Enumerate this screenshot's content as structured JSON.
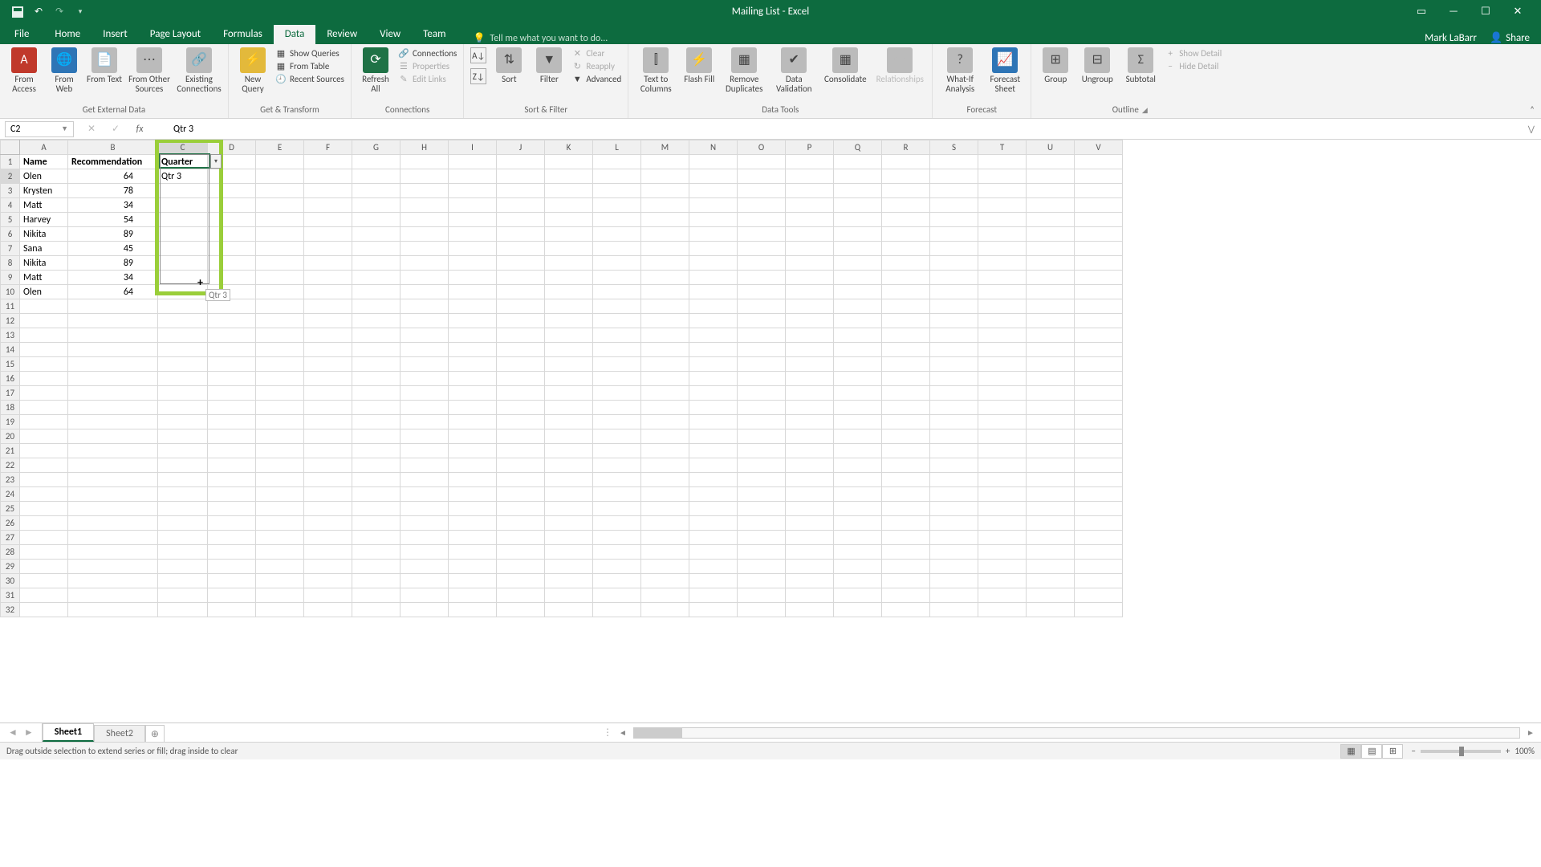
{
  "title": "Mailing List - Excel",
  "user": "Mark LaBarr",
  "share_label": "Share",
  "tabs": [
    "File",
    "Home",
    "Insert",
    "Page Layout",
    "Formulas",
    "Data",
    "Review",
    "View",
    "Team"
  ],
  "active_tab": "Data",
  "tellme_placeholder": "Tell me what you want to do...",
  "ribbon": {
    "groups": {
      "ext": {
        "label": "Get External Data",
        "items": [
          "From Access",
          "From Web",
          "From Text",
          "From Other Sources",
          "Existing Connections"
        ]
      },
      "trans": {
        "label": "Get & Transform",
        "new_query": "New Query",
        "show_queries": "Show Queries",
        "from_table": "From Table",
        "recent_sources": "Recent Sources"
      },
      "conn": {
        "label": "Connections",
        "refresh": "Refresh All",
        "connections": "Connections",
        "properties": "Properties",
        "edit_links": "Edit Links"
      },
      "sortf": {
        "label": "Sort & Filter",
        "sort": "Sort",
        "filter": "Filter",
        "clear": "Clear",
        "reapply": "Reapply",
        "advanced": "Advanced"
      },
      "tools": {
        "label": "Data Tools",
        "text_to_cols": "Text to Columns",
        "flash_fill": "Flash Fill",
        "remove_dup": "Remove Duplicates",
        "validation": "Data Validation",
        "consolidate": "Consolidate",
        "relationships": "Relationships"
      },
      "forecast": {
        "label": "Forecast",
        "whatif": "What-If Analysis",
        "fsheet": "Forecast Sheet"
      },
      "outline": {
        "label": "Outline",
        "group": "Group",
        "ungroup": "Ungroup",
        "subtotal": "Subtotal",
        "show_detail": "Show Detail",
        "hide_detail": "Hide Detail"
      }
    }
  },
  "namebox": "C2",
  "formula_value": "Qtr 3",
  "columns": [
    "A",
    "B",
    "C",
    "D",
    "E",
    "F",
    "G",
    "H",
    "I",
    "J",
    "K",
    "L",
    "M",
    "N",
    "O",
    "P",
    "Q",
    "R",
    "S",
    "T",
    "U",
    "V"
  ],
  "col_widths": {
    "A": 60,
    "B": 112,
    "C": 62,
    "default": 60
  },
  "rows_visible": 32,
  "headers": {
    "A": "Name",
    "B": "Recommendation",
    "C": "Quarter"
  },
  "data_rows": [
    {
      "A": "Olen",
      "B": "64"
    },
    {
      "A": "Krysten",
      "B": "78"
    },
    {
      "A": "Matt",
      "B": "34"
    },
    {
      "A": "Harvey",
      "B": "54"
    },
    {
      "A": "Nikita",
      "B": "89"
    },
    {
      "A": "Sana",
      "B": "45"
    },
    {
      "A": "Nikita",
      "B": "89"
    },
    {
      "A": "Matt",
      "B": "34"
    },
    {
      "A": "Olen",
      "B": "64"
    }
  ],
  "cell_C2": "Qtr 3",
  "drag_tooltip": "Qtr 3",
  "sheets": [
    "Sheet1",
    "Sheet2"
  ],
  "active_sheet": "Sheet1",
  "status_text": "Drag outside selection to extend series or fill; drag inside to clear",
  "zoom_label": "100%"
}
